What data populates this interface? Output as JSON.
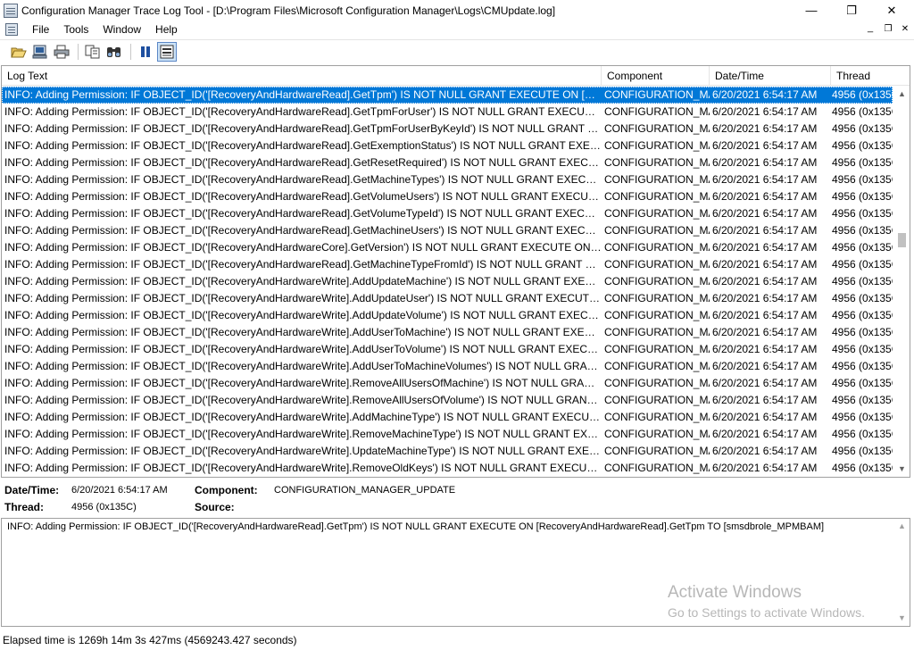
{
  "window": {
    "title": "Configuration Manager Trace Log Tool - [D:\\Program Files\\Microsoft Configuration Manager\\Logs\\CMUpdate.log]",
    "minimize_glyph": "—",
    "maximize_glyph": "❐",
    "close_glyph": "✕"
  },
  "menu": {
    "items": [
      "File",
      "Tools",
      "Window",
      "Help"
    ],
    "mdi_minimize": "_",
    "mdi_restore": "❐",
    "mdi_close": "✕"
  },
  "toolbar": {
    "buttons": [
      "open-icon",
      "open-on-server-icon",
      "print-icon",
      "copy-icon",
      "find-icon",
      "pause-icon",
      "show-details-icon"
    ]
  },
  "log": {
    "columns": [
      "Log Text",
      "Component",
      "Date/Time",
      "Thread"
    ],
    "rows": [
      {
        "text": "INFO: Adding Permission: IF OBJECT_ID('[RecoveryAndHardwareRead].GetTpm') IS NOT NULL GRANT EXECUTE ON [Recover...",
        "component": "CONFIGURATION_MA",
        "datetime": "6/20/2021 6:54:17 AM",
        "thread": "4956 (0x135C"
      },
      {
        "text": "INFO: Adding Permission: IF OBJECT_ID('[RecoveryAndHardwareRead].GetTpmForUser') IS NOT NULL GRANT EXECUTE ON [...",
        "component": "CONFIGURATION_MA",
        "datetime": "6/20/2021 6:54:17 AM",
        "thread": "4956 (0x135C"
      },
      {
        "text": "INFO: Adding Permission: IF OBJECT_ID('[RecoveryAndHardwareRead].GetTpmForUserByKeyId') IS NOT NULL GRANT EXECU...",
        "component": "CONFIGURATION_MA",
        "datetime": "6/20/2021 6:54:17 AM",
        "thread": "4956 (0x135C"
      },
      {
        "text": "INFO: Adding Permission: IF OBJECT_ID('[RecoveryAndHardwareRead].GetExemptionStatus') IS NOT NULL GRANT EXECUTE ...",
        "component": "CONFIGURATION_MA",
        "datetime": "6/20/2021 6:54:17 AM",
        "thread": "4956 (0x135C"
      },
      {
        "text": "INFO: Adding Permission: IF OBJECT_ID('[RecoveryAndHardwareRead].GetResetRequired') IS NOT NULL GRANT EXECUTE O...",
        "component": "CONFIGURATION_MA",
        "datetime": "6/20/2021 6:54:17 AM",
        "thread": "4956 (0x135C"
      },
      {
        "text": "INFO: Adding Permission: IF OBJECT_ID('[RecoveryAndHardwareRead].GetMachineTypes') IS NOT NULL GRANT EXECUTE ON ...",
        "component": "CONFIGURATION_MA",
        "datetime": "6/20/2021 6:54:17 AM",
        "thread": "4956 (0x135C"
      },
      {
        "text": "INFO: Adding Permission: IF OBJECT_ID('[RecoveryAndHardwareRead].GetVolumeUsers') IS NOT NULL GRANT EXECUTE ON ...",
        "component": "CONFIGURATION_MA",
        "datetime": "6/20/2021 6:54:17 AM",
        "thread": "4956 (0x135C"
      },
      {
        "text": "INFO: Adding Permission: IF OBJECT_ID('[RecoveryAndHardwareRead].GetVolumeTypeId') IS NOT NULL GRANT EXECUTE O...",
        "component": "CONFIGURATION_MA",
        "datetime": "6/20/2021 6:54:17 AM",
        "thread": "4956 (0x135C"
      },
      {
        "text": "INFO: Adding Permission: IF OBJECT_ID('[RecoveryAndHardwareRead].GetMachineUsers') IS NOT NULL GRANT EXECUTE ON...",
        "component": "CONFIGURATION_MA",
        "datetime": "6/20/2021 6:54:17 AM",
        "thread": "4956 (0x135C"
      },
      {
        "text": "INFO: Adding Permission: IF OBJECT_ID('[RecoveryAndHardwareCore].GetVersion') IS NOT NULL GRANT EXECUTE ON [Reco...",
        "component": "CONFIGURATION_MA",
        "datetime": "6/20/2021 6:54:17 AM",
        "thread": "4956 (0x135C"
      },
      {
        "text": "INFO: Adding Permission: IF OBJECT_ID('[RecoveryAndHardwareRead].GetMachineTypeFromId') IS NOT NULL GRANT EXEC...",
        "component": "CONFIGURATION_MA",
        "datetime": "6/20/2021 6:54:17 AM",
        "thread": "4956 (0x135C"
      },
      {
        "text": "INFO: Adding Permission: IF OBJECT_ID('[RecoveryAndHardwareWrite].AddUpdateMachine') IS NOT NULL GRANT EXECUTE ...",
        "component": "CONFIGURATION_MA",
        "datetime": "6/20/2021 6:54:17 AM",
        "thread": "4956 (0x135C"
      },
      {
        "text": "INFO: Adding Permission: IF OBJECT_ID('[RecoveryAndHardwareWrite].AddUpdateUser') IS NOT NULL GRANT EXECUTE ON [...",
        "component": "CONFIGURATION_MA",
        "datetime": "6/20/2021 6:54:17 AM",
        "thread": "4956 (0x135C"
      },
      {
        "text": "INFO: Adding Permission: IF OBJECT_ID('[RecoveryAndHardwareWrite].AddUpdateVolume') IS NOT NULL GRANT EXECUTE ...",
        "component": "CONFIGURATION_MA",
        "datetime": "6/20/2021 6:54:17 AM",
        "thread": "4956 (0x135C"
      },
      {
        "text": "INFO: Adding Permission: IF OBJECT_ID('[RecoveryAndHardwareWrite].AddUserToMachine') IS NOT NULL GRANT EXECUTE ...",
        "component": "CONFIGURATION_MA",
        "datetime": "6/20/2021 6:54:17 AM",
        "thread": "4956 (0x135C"
      },
      {
        "text": "INFO: Adding Permission: IF OBJECT_ID('[RecoveryAndHardwareWrite].AddUserToVolume') IS NOT NULL GRANT EXECUTE O...",
        "component": "CONFIGURATION_MA",
        "datetime": "6/20/2021 6:54:17 AM",
        "thread": "4956 (0x135C"
      },
      {
        "text": "INFO: Adding Permission: IF OBJECT_ID('[RecoveryAndHardwareWrite].AddUserToMachineVolumes') IS NOT NULL GRANT E...",
        "component": "CONFIGURATION_MA",
        "datetime": "6/20/2021 6:54:17 AM",
        "thread": "4956 (0x135C"
      },
      {
        "text": "INFO: Adding Permission: IF OBJECT_ID('[RecoveryAndHardwareWrite].RemoveAllUsersOfMachine') IS NOT NULL GRANT EX...",
        "component": "CONFIGURATION_MA",
        "datetime": "6/20/2021 6:54:17 AM",
        "thread": "4956 (0x135C"
      },
      {
        "text": "INFO: Adding Permission: IF OBJECT_ID('[RecoveryAndHardwareWrite].RemoveAllUsersOfVolume') IS NOT NULL GRANT EXE...",
        "component": "CONFIGURATION_MA",
        "datetime": "6/20/2021 6:54:17 AM",
        "thread": "4956 (0x135C"
      },
      {
        "text": "INFO: Adding Permission: IF OBJECT_ID('[RecoveryAndHardwareWrite].AddMachineType') IS NOT NULL GRANT EXECUTE O...",
        "component": "CONFIGURATION_MA",
        "datetime": "6/20/2021 6:54:17 AM",
        "thread": "4956 (0x135C"
      },
      {
        "text": "INFO: Adding Permission: IF OBJECT_ID('[RecoveryAndHardwareWrite].RemoveMachineType') IS NOT NULL GRANT EXECUTE...",
        "component": "CONFIGURATION_MA",
        "datetime": "6/20/2021 6:54:17 AM",
        "thread": "4956 (0x135C"
      },
      {
        "text": "INFO: Adding Permission: IF OBJECT_ID('[RecoveryAndHardwareWrite].UpdateMachineType') IS NOT NULL GRANT EXECUTE...",
        "component": "CONFIGURATION_MA",
        "datetime": "6/20/2021 6:54:17 AM",
        "thread": "4956 (0x135C"
      },
      {
        "text": "INFO: Adding Permission: IF OBJECT_ID('[RecoveryAndHardwareWrite].RemoveOldKeys') IS NOT NULL GRANT EXECUTE ON ...",
        "component": "CONFIGURATION_MA",
        "datetime": "6/20/2021 6:54:17 AM",
        "thread": "4956 (0x135C"
      }
    ],
    "selected_index": 0,
    "scroll_fraction": 0.38
  },
  "details": {
    "datetime_label": "Date/Time:",
    "datetime_value": "6/20/2021 6:54:17 AM",
    "component_label": "Component:",
    "component_value": "CONFIGURATION_MANAGER_UPDATE",
    "thread_label": "Thread:",
    "thread_value": "4956 (0x135C)",
    "source_label": "Source:",
    "source_value": ""
  },
  "message": {
    "text": "INFO: Adding Permission: IF OBJECT_ID('[RecoveryAndHardwareRead].GetTpm') IS NOT NULL GRANT EXECUTE ON [RecoveryAndHardwareRead].GetTpm TO [smsdbrole_MPMBAM]"
  },
  "watermark": {
    "line1": "Activate Windows",
    "line2": "Go to Settings to activate Windows."
  },
  "status": {
    "text": "Elapsed time is 1269h 14m 3s 427ms (4569243.427 seconds)"
  },
  "colors": {
    "selection": "#0078d7",
    "border": "#a0a0a0",
    "watermark": "#b7b7b7"
  }
}
